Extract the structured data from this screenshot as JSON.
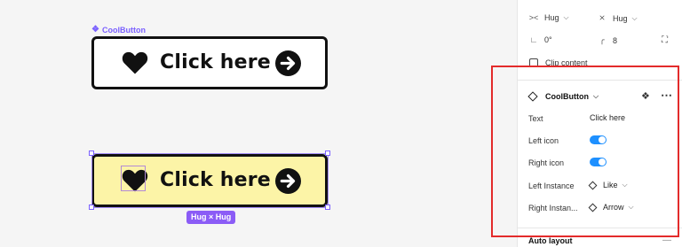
{
  "canvas": {
    "component_label": "CoolButton",
    "button_text": "Click here",
    "hug_badge": "Hug × Hug"
  },
  "panel": {
    "width_mode": "Hug",
    "height_mode": "Hug",
    "rotation": "0°",
    "corner_radius": "8",
    "clip_content_label": "Clip content",
    "component_name": "CoolButton",
    "properties": [
      {
        "label": "Text",
        "value": "Click here",
        "type": "text"
      },
      {
        "label": "Left icon",
        "value": "on",
        "type": "toggle"
      },
      {
        "label": "Right icon",
        "value": "on",
        "type": "toggle"
      },
      {
        "label": "Left Instance",
        "value": "Like",
        "type": "instance"
      },
      {
        "label": "Right Instan...",
        "value": "Arrow",
        "type": "instance"
      }
    ],
    "auto_layout_label": "Auto layout"
  },
  "colors": {
    "accent": "#7b61ff",
    "button_highlight": "#fcf4a7",
    "toggle_on": "#1e90ff",
    "annotation": "#e32b2b"
  },
  "icons": {
    "component": "component-icon",
    "heart": "heart-icon",
    "arrow": "arrow-right-circle-icon",
    "more": "more-icon"
  }
}
